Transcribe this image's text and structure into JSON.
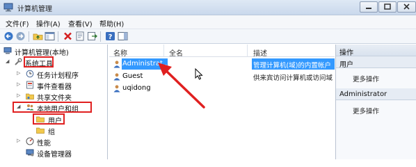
{
  "window": {
    "title": "计算机管理"
  },
  "menu": [
    "文件(F)",
    "操作(A)",
    "查看(V)",
    "帮助(H)"
  ],
  "toolbar_icons": [
    "back-icon",
    "forward-icon",
    "up-folder-icon",
    "show-hide-tree-icon",
    "delete-icon",
    "properties-icon",
    "export-icon",
    "help-icon",
    "action-pane-icon"
  ],
  "tree": [
    {
      "label": "计算机管理(本地)",
      "icon": "computer-icon"
    },
    {
      "label": "系统工具",
      "icon": "tools-icon"
    },
    {
      "label": "任务计划程序",
      "icon": "clock-icon"
    },
    {
      "label": "事件查看器",
      "icon": "event-viewer-icon"
    },
    {
      "label": "共享文件夹",
      "icon": "shared-folder-icon"
    },
    {
      "label": "本地用户和组",
      "icon": "users-icon"
    },
    {
      "label": "用户",
      "icon": "folder-icon"
    },
    {
      "label": "组",
      "icon": "folder-icon"
    },
    {
      "label": "性能",
      "icon": "performance-icon"
    },
    {
      "label": "设备管理器",
      "icon": "device-manager-icon"
    }
  ],
  "list": {
    "columns": [
      "名称",
      "全名",
      "描述"
    ],
    "rows": [
      {
        "name": "Administrat...",
        "fullname": "",
        "desc": "管理计算机(域)的内置帐户"
      },
      {
        "name": "Guest",
        "fullname": "",
        "desc": "供来宾访问计算机或访问域"
      },
      {
        "name": "uqidong",
        "fullname": "",
        "desc": ""
      }
    ]
  },
  "actions": {
    "title": "操作",
    "sections": [
      {
        "header": "用户",
        "item": "更多操作"
      },
      {
        "header": "Administrator",
        "item": "更多操作"
      }
    ]
  },
  "colors": {
    "selection": "#3399ff",
    "annotation": "#e02020"
  }
}
